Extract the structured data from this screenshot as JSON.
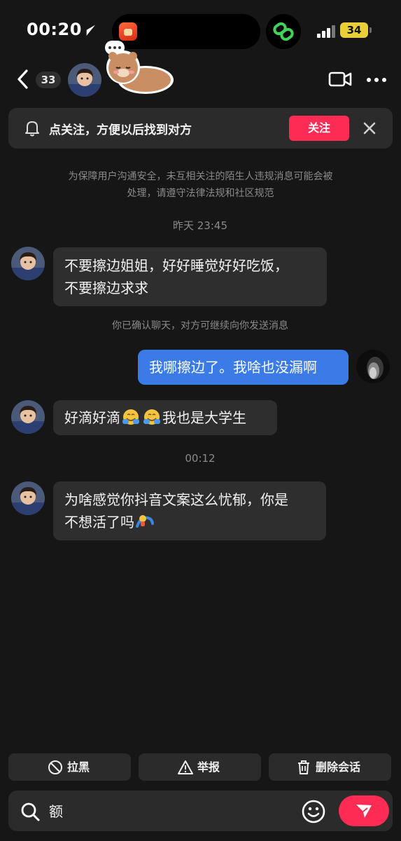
{
  "status_bar": {
    "time": "00:20",
    "battery": "34"
  },
  "header": {
    "unread_count": "33"
  },
  "follow_banner": {
    "text": "点关注，方便以后找到对方",
    "button_label": "关注"
  },
  "notices": {
    "safety_line1": "为保障用户沟通安全，未互相关注的陌生人违规消息可能会被",
    "safety_line2": "处理，请遵守法律法规和社区规范",
    "confirmed": "你已确认聊天，对方可继续向你发送消息"
  },
  "timestamps": {
    "first": "昨天 23:45",
    "second": "00:12"
  },
  "messages": [
    {
      "side": "in",
      "line1": "不要擦边姐姐，好好睡觉好好吃饭，",
      "line2": "不要擦边求求"
    },
    {
      "side": "out",
      "text": "我哪擦边了。我啥也没漏啊"
    },
    {
      "side": "in",
      "text_a": "好滴好滴",
      "text_b": "我也是大学生"
    },
    {
      "side": "in",
      "line1": "为啥感觉你抖音文案这么忧郁，你是",
      "line2": "不想活了吗"
    }
  ],
  "actions": {
    "block_label": "拉黑",
    "report_label": "举报",
    "delete_label": "删除会话"
  },
  "input": {
    "value": "额"
  },
  "colors": {
    "accent": "#fe2c55",
    "outgoing_bubble": "#3a7be8",
    "incoming_bubble": "#2e2e2e",
    "background": "#161616"
  }
}
